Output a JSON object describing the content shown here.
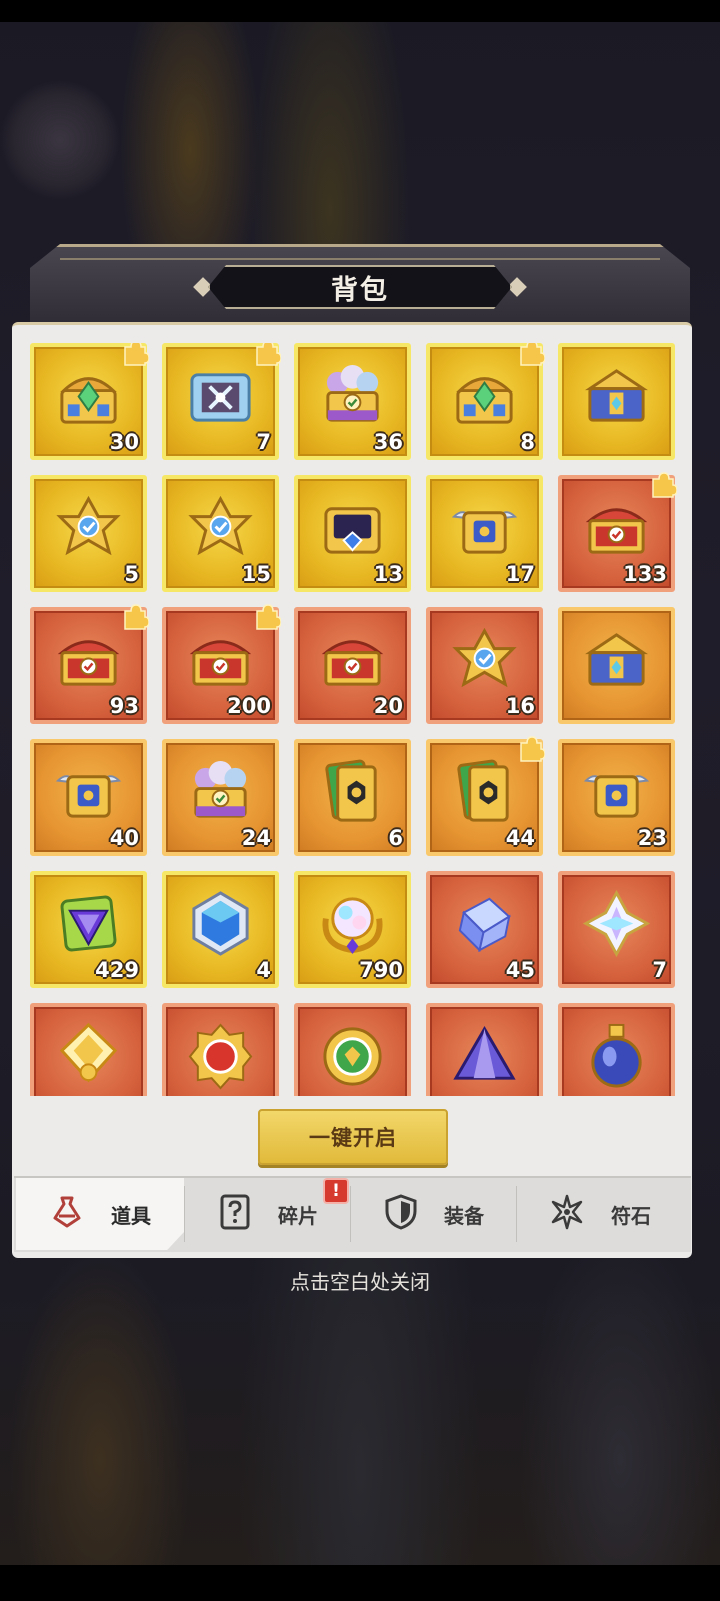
{
  "window": {
    "title": "背包"
  },
  "items": [
    {
      "count": "30",
      "bg": "gold",
      "art": "chest-gem",
      "corner": true
    },
    {
      "count": "7",
      "bg": "gold",
      "art": "chest-silver",
      "corner": true
    },
    {
      "count": "36",
      "bg": "gold",
      "art": "chest-orbs",
      "corner": false
    },
    {
      "count": "8",
      "bg": "gold",
      "art": "chest-gem",
      "corner": true
    },
    {
      "count": "",
      "bg": "gold",
      "art": "chest-blue",
      "corner": false
    },
    {
      "count": "5",
      "bg": "gold",
      "art": "chest-star",
      "corner": false
    },
    {
      "count": "15",
      "bg": "gold",
      "art": "chest-star",
      "corner": false
    },
    {
      "count": "13",
      "bg": "gold",
      "art": "chest-dark",
      "corner": false
    },
    {
      "count": "17",
      "bg": "gold",
      "art": "chest-winged",
      "corner": false
    },
    {
      "count": "133",
      "bg": "red",
      "art": "chest-red",
      "corner": true
    },
    {
      "count": "93",
      "bg": "red",
      "art": "chest-red",
      "corner": true
    },
    {
      "count": "200",
      "bg": "red",
      "art": "chest-red",
      "corner": true
    },
    {
      "count": "20",
      "bg": "red",
      "art": "chest-red",
      "corner": false
    },
    {
      "count": "16",
      "bg": "red",
      "art": "chest-star",
      "corner": false
    },
    {
      "count": "",
      "bg": "orange",
      "art": "chest-blue",
      "corner": false
    },
    {
      "count": "40",
      "bg": "orange",
      "art": "chest-winged",
      "corner": false
    },
    {
      "count": "24",
      "bg": "orange",
      "art": "chest-orbs",
      "corner": false
    },
    {
      "count": "6",
      "bg": "orange",
      "art": "card-pack",
      "corner": false
    },
    {
      "count": "44",
      "bg": "orange",
      "art": "card-pack",
      "corner": true
    },
    {
      "count": "23",
      "bg": "orange",
      "art": "chest-winged",
      "corner": false
    },
    {
      "count": "429",
      "bg": "gold",
      "art": "gem-triangle",
      "corner": false
    },
    {
      "count": "4",
      "bg": "gold",
      "art": "gem-blue",
      "corner": false
    },
    {
      "count": "790",
      "bg": "gold",
      "art": "orb-rainbow",
      "corner": false
    },
    {
      "count": "45",
      "bg": "red",
      "art": "crystal-cube",
      "corner": false
    },
    {
      "count": "7",
      "bg": "red",
      "art": "crystal-star",
      "corner": false
    },
    {
      "count": "",
      "bg": "red",
      "art": "crystal-gold",
      "corner": false
    },
    {
      "count": "",
      "bg": "red",
      "art": "emblem-red",
      "corner": false
    },
    {
      "count": "",
      "bg": "red",
      "art": "emblem-green",
      "corner": false
    },
    {
      "count": "",
      "bg": "red",
      "art": "crystal-purple",
      "corner": false
    },
    {
      "count": "",
      "bg": "red",
      "art": "potion-blue",
      "corner": false
    }
  ],
  "open_all_label": "一键开启",
  "tabs": [
    {
      "label": "道具",
      "icon": "potion-tab-icon",
      "active": true
    },
    {
      "label": "碎片",
      "icon": "question-tab-icon",
      "active": false
    },
    {
      "label": "装备",
      "icon": "shield-tab-icon",
      "active": false
    },
    {
      "label": "符石",
      "icon": "rune-tab-icon",
      "active": false
    }
  ],
  "tab_badge": "!",
  "close_hint": "点击空白处关闭",
  "colors": {
    "gold_tile": "#e7b722",
    "red_tile": "#d6633e",
    "orange_tile": "#e69532",
    "button": "#e1ba3a",
    "badge": "#d63a2e"
  }
}
